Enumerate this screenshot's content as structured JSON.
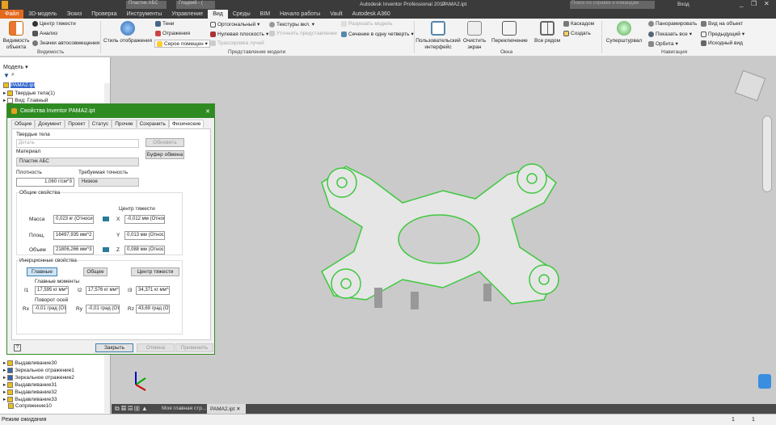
{
  "app": {
    "title": "Autodesk Inventor Professional 2017",
    "file": "РАМА2.ipt",
    "search_placeholder": "Поиск по справке и командам",
    "login": "Вход",
    "material_combo": "Пластик АБС",
    "visual_combo": "Гладкий - (",
    "accent": "#2e8b22"
  },
  "ribbon_tabs": [
    "Файл",
    "3D-модель",
    "Эскиз",
    "Проверка",
    "Инструменты",
    "Управление",
    "Вид",
    "Среды",
    "BIM",
    "Начало работы",
    "Vault",
    "Autodesk A360"
  ],
  "ribbon": {
    "visibility": {
      "big": "Видимость объекта",
      "items": [
        "Центр тяжести",
        "Анализ",
        "Значки автосовмещения"
      ],
      "group": "Видимость"
    },
    "model": {
      "style": "Стиль отображения",
      "items": [
        "Тени",
        "Отражения",
        "Серое помещен",
        "Ортогональный",
        "Нулевая плоскость",
        "Трассировка лучей",
        "Текстуры вкл.",
        "Уточнить представление",
        "Разрезать модель",
        "Сечение в одну четверть"
      ],
      "group": "Представление модели"
    },
    "windows": {
      "items": [
        "Пользовательский интерфейс",
        "Очистить экран",
        "Переключение",
        "Все рядом",
        "Каскадом",
        "Создать"
      ],
      "group": "Окна"
    },
    "nav": {
      "items": [
        "Суперштурвал",
        "Панорамировать",
        "Показать все",
        "Орбита",
        "Вид на объект",
        "Предыдущий",
        "Исходный вид"
      ],
      "group": "Навигация"
    }
  },
  "browser": {
    "title": "Модель",
    "root": "РАМА2.ipt",
    "top_items": [
      "Твердые тела(1)",
      "Вид: Главный"
    ],
    "bottom_items": [
      "Выдавливание30",
      "Зеркальное отражение1",
      "Зеркальное отражение2",
      "Выдавливание31",
      "Выдавливание32",
      "Выдавливание33",
      "Сопряжение10"
    ]
  },
  "dialog": {
    "title": "Свойства Inventor РАМА2.ipt",
    "tabs": [
      "Общие",
      "Документ",
      "Проект",
      "Статус",
      "Прочие",
      "Сохранить",
      "Физические"
    ],
    "solids_label": "Твердые тела",
    "solids_value": "Деталь",
    "update": "Обновить",
    "clipboard": "Буфер обмена",
    "material_label": "Материал",
    "material": "Пластик АБС",
    "density_label": "Плотность",
    "density": "1,060 г/см^3",
    "accuracy_label": "Требуемая точность",
    "accuracy": "Низкое",
    "general": {
      "title": "Общие свойства",
      "cog": "Центр тяжести",
      "mass_label": "Масса",
      "mass": "0,023 кг (Относит",
      "area_label": "Площ.",
      "area": "16497,935 мм^2 (О",
      "volume_label": "Объем",
      "volume": "21806,266 мм^3 (О",
      "x_label": "X",
      "x": "-0,012 мм (Относит",
      "y_label": "Y",
      "y": "0,013 мм (Относит",
      "z_label": "Z",
      "z": "0,088 мм (Относит"
    },
    "inertia": {
      "title": "Инерционные свойства",
      "btn_main": "Главные",
      "btn_general": "Общее",
      "btn_cog": "Центр тяжести",
      "moments": "Главные моменты",
      "i1_label": "I1",
      "i1": "17,595 кг мм^2",
      "i2_label": "I2",
      "i2": "17,576 кг мм^2",
      "i3_label": "I3",
      "i3": "34,371 кг мм^2",
      "rotation": "Поворот осей",
      "rx_label": "Rx",
      "rx": "-0,01 град (От",
      "ry_label": "Ry",
      "ry": "-0,01 град (От",
      "rz_label": "Rz",
      "rz": "43,69 град (От"
    },
    "close": "Закрыть",
    "cancel": "Отмена",
    "apply": "Применить"
  },
  "doc_tabs": [
    "Моя главная стр...",
    "РАМА2.ipt"
  ],
  "status": {
    "text": "Режим ожидания",
    "n1": "1",
    "n2": "1"
  }
}
